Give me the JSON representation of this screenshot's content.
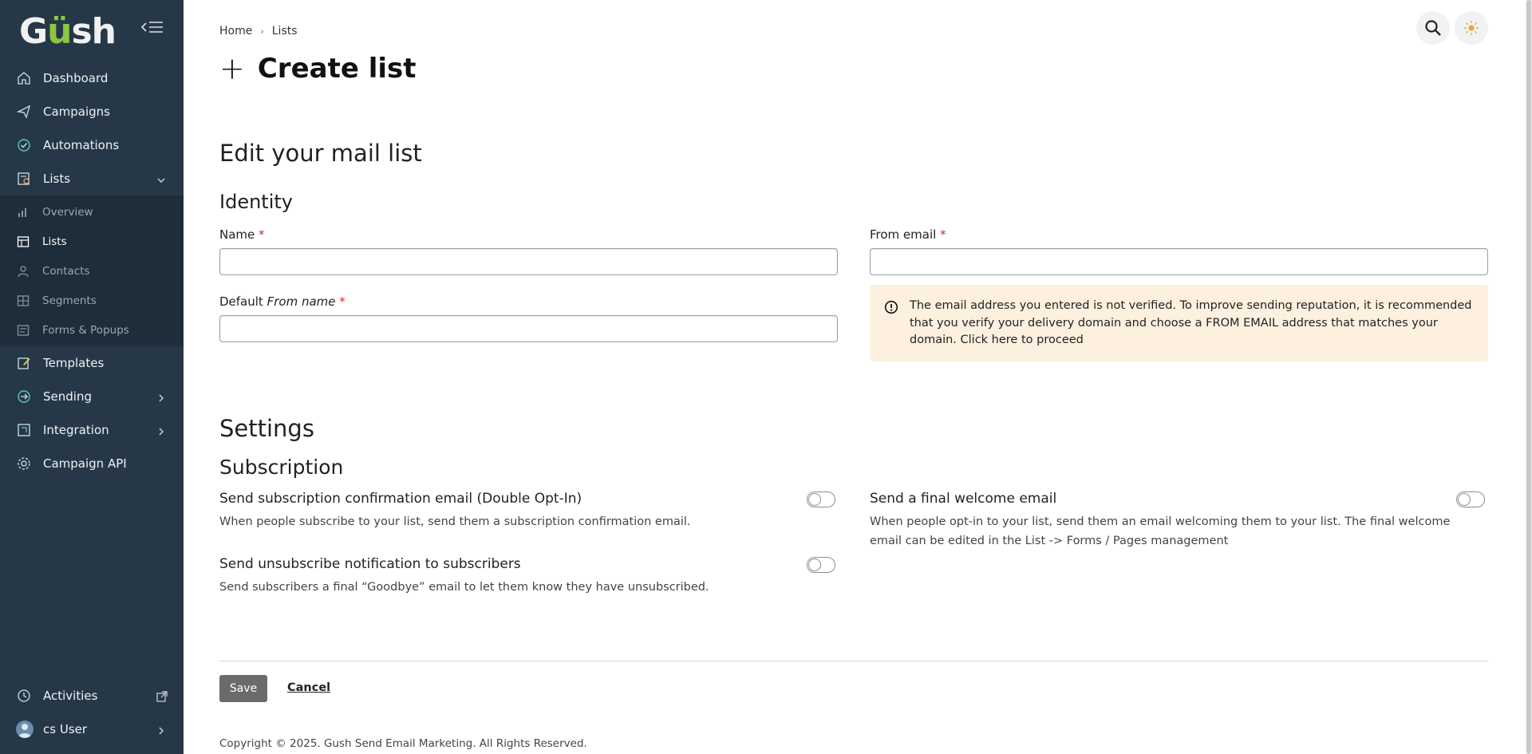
{
  "brand": {
    "logo_text_pre": "G",
    "logo_text_dots": "ü",
    "logo_text_post": "sh",
    "accent": "#8cc63f",
    "sidebar_bg": "#263848"
  },
  "sidebar": {
    "items": [
      {
        "label": "Dashboard",
        "icon": "home-icon"
      },
      {
        "label": "Campaigns",
        "icon": "send-icon"
      },
      {
        "label": "Automations",
        "icon": "automation-icon"
      },
      {
        "label": "Lists",
        "icon": "lists-icon",
        "expanded": true
      }
    ],
    "subitems": [
      {
        "label": "Overview",
        "icon": "chart-icon"
      },
      {
        "label": "Lists",
        "icon": "table-icon",
        "active": true
      },
      {
        "label": "Contacts",
        "icon": "user-icon"
      },
      {
        "label": "Segments",
        "icon": "segment-icon"
      },
      {
        "label": "Forms & Popups",
        "icon": "form-icon"
      }
    ],
    "items_after": [
      {
        "label": "Templates",
        "icon": "edit-icon"
      },
      {
        "label": "Sending",
        "icon": "sending-icon"
      },
      {
        "label": "Integration",
        "icon": "integration-icon"
      },
      {
        "label": "Campaign API",
        "icon": "api-icon"
      }
    ],
    "bottom": {
      "activities": "Activities",
      "user": "cs User"
    }
  },
  "breadcrumb": {
    "home": "Home",
    "current": "Lists"
  },
  "page": {
    "title": "Create list",
    "section_heading": "Edit your mail list",
    "identity_heading": "Identity",
    "settings_heading": "Settings",
    "subscription_heading": "Subscription"
  },
  "form": {
    "name_label": "Name",
    "from_email_label": "From email",
    "default_label_pre": "Default",
    "default_label_em": "From name",
    "required_mark": "*",
    "name_value": "",
    "from_email_value": "",
    "from_name_value": ""
  },
  "alert": {
    "text": "The email address you entered is not verified. To improve sending reputation, it is recommended that you verify your delivery domain and choose a FROM EMAIL address that matches your domain. Click here to proceed",
    "bg": "#fdf0df"
  },
  "options": {
    "double_optin": {
      "title": "Send subscription confirmation email (Double Opt-In)",
      "desc": "When people subscribe to your list, send them a subscription confirmation email.",
      "enabled": false
    },
    "unsubscribe": {
      "title": "Send unsubscribe notification to subscribers",
      "desc": "Send subscribers a final “Goodbye” email to let them know they have unsubscribed.",
      "enabled": false
    },
    "welcome": {
      "title": "Send a final welcome email",
      "desc_line1": "When people opt-in to your list, send them an email welcoming them to your list. The final welcome",
      "desc_line2": "email can be edited in the List -> Forms / Pages management",
      "enabled": false
    }
  },
  "actions": {
    "save": "Save",
    "cancel": "Cancel"
  },
  "footer": {
    "text": "Copyright © 2025. Gush Send Email Marketing. All Rights Reserved."
  }
}
